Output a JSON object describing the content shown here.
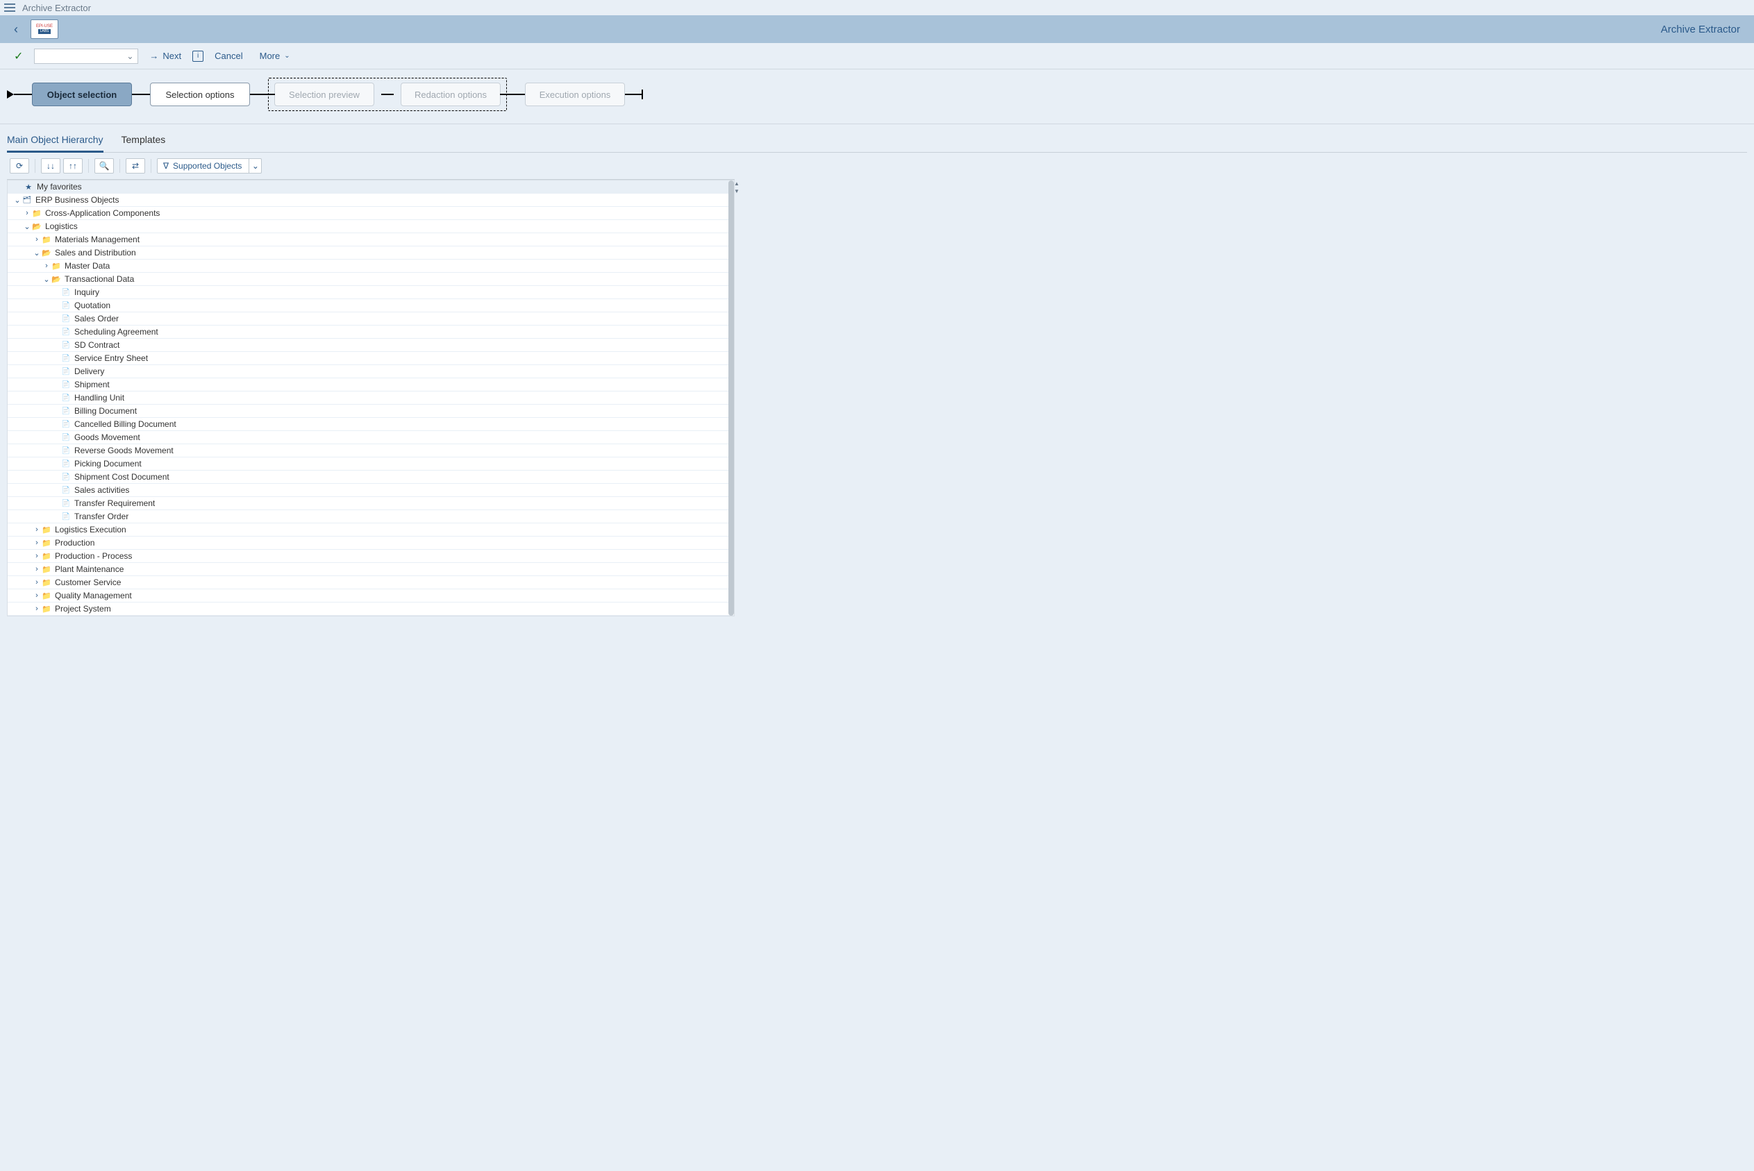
{
  "header": {
    "app_title": "Archive Extractor",
    "page_title": "Archive Extractor",
    "logo_top": "EPI-USE",
    "logo_bottom": "LABS"
  },
  "actions": {
    "next": "Next",
    "cancel": "Cancel",
    "more": "More"
  },
  "train": {
    "step1": "Object selection",
    "step2": "Selection options",
    "step3": "Selection preview",
    "step4": "Redaction options",
    "step5": "Execution options"
  },
  "tabs": {
    "tab1": "Main Object Hierarchy",
    "tab2": "Templates"
  },
  "filter": {
    "label": "Supported Objects"
  },
  "tree": {
    "favorites": "My favorites",
    "erp": "ERP Business Objects",
    "cross_app": "Cross-Application Components",
    "logistics": "Logistics",
    "mm": "Materials Management",
    "sd": "Sales and Distribution",
    "master_data": "Master Data",
    "trans_data": "Transactional Data",
    "items": {
      "inquiry": "Inquiry",
      "quotation": "Quotation",
      "sales_order": "Sales Order",
      "scheduling_agreement": "Scheduling Agreement",
      "sd_contract": "SD Contract",
      "service_entry": "Service Entry Sheet",
      "delivery": "Delivery",
      "shipment": "Shipment",
      "handling_unit": "Handling Unit",
      "billing_doc": "Billing Document",
      "cancelled_billing": "Cancelled Billing Document",
      "goods_movement": "Goods Movement",
      "reverse_goods": "Reverse Goods Movement",
      "picking_doc": "Picking Document",
      "shipment_cost": "Shipment Cost Document",
      "sales_activities": "Sales activities",
      "transfer_req": "Transfer Requirement",
      "transfer_order": "Transfer Order"
    },
    "log_exec": "Logistics Execution",
    "production": "Production",
    "production_proc": "Production - Process",
    "plant_maint": "Plant Maintenance",
    "cust_service": "Customer Service",
    "quality_mgmt": "Quality Management",
    "project_system": "Project System"
  }
}
